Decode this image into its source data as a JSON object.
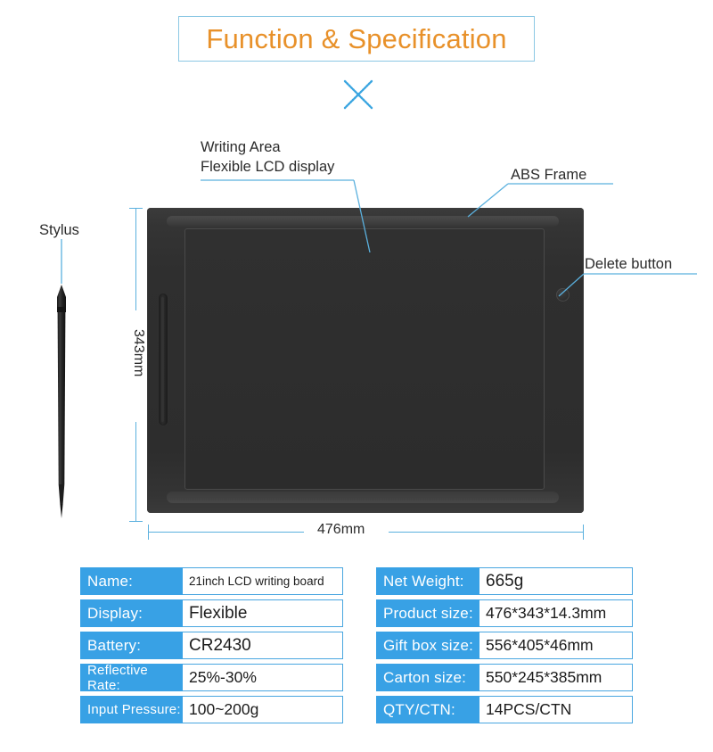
{
  "title": "Function & Specification",
  "colors": {
    "title_text": "#e8912a",
    "title_border": "#8cc8e4",
    "accent_blue": "#38a1e5",
    "leader_blue": "#5ab0de",
    "device_body": "#2f2f2f",
    "screen": "#2e2e2e"
  },
  "callouts": [
    {
      "id": "writing-area",
      "line1": "Writing Area",
      "line2": "Flexible LCD display"
    },
    {
      "id": "abs-frame",
      "label": "ABS Frame"
    },
    {
      "id": "delete-button",
      "label": "Delete button"
    },
    {
      "id": "stylus",
      "label": "Stylus"
    }
  ],
  "dimensions": {
    "height": "343mm",
    "width": "476mm"
  },
  "spec_left": [
    {
      "key": "Name:",
      "value": "21inch LCD writing board"
    },
    {
      "key": "Display:",
      "value": "Flexible"
    },
    {
      "key": "Battery:",
      "value": "CR2430"
    },
    {
      "key": "Reflective Rate:",
      "value": "25%-30%"
    },
    {
      "key": "Input Pressure:",
      "value": "100~200g"
    }
  ],
  "spec_right": [
    {
      "key": "Net Weight:",
      "value": "665g"
    },
    {
      "key": "Product size:",
      "value": "476*343*14.3mm"
    },
    {
      "key": "Gift box size:",
      "value": "556*405*46mm"
    },
    {
      "key": "Carton size:",
      "value": "550*245*385mm"
    },
    {
      "key": "QTY/CTN:",
      "value": "14PCS/CTN"
    }
  ]
}
